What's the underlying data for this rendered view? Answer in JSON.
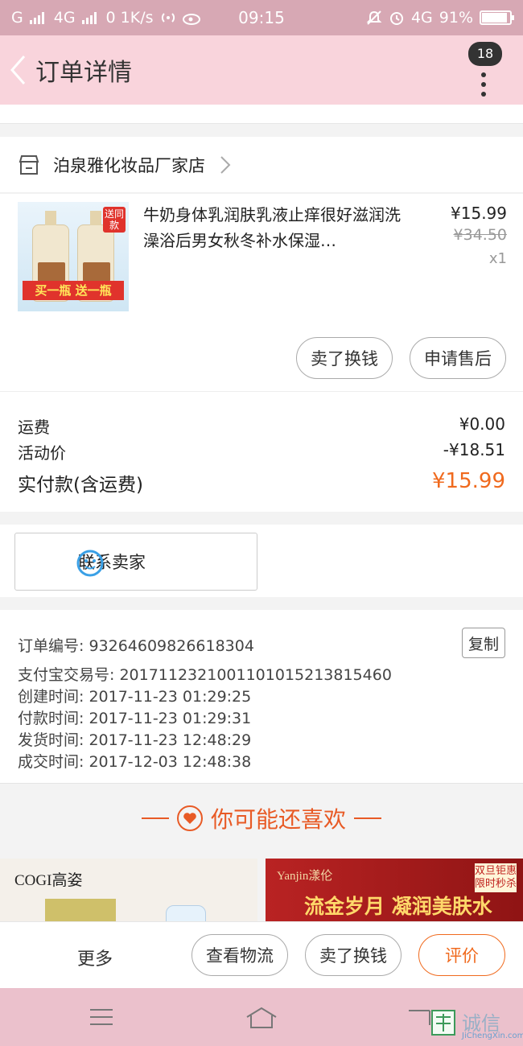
{
  "status_bar": {
    "network_left": "G",
    "network_4g": "4G",
    "speed": "0 1K/s",
    "time": "09:15",
    "network_right": "4G",
    "battery_text": "91%",
    "battery_level": 0.91
  },
  "nav": {
    "title": "订单详情",
    "badge": "18"
  },
  "shop": {
    "name": "泊泉雅化妆品厂家店"
  },
  "goods": {
    "name": "牛奶身体乳润肤乳液止痒很好滋润洗澡浴后男女秋冬补水保湿…",
    "price": "¥15.99",
    "original_price": "¥34.50",
    "quantity": "x1",
    "image_banner": "买一瓶 送一瓶",
    "image_tag": "送同款",
    "resell_label": "卖了换钱",
    "aftersale_label": "申请售后"
  },
  "fees": {
    "shipping_label": "运费",
    "shipping_value": "¥0.00",
    "promo_label": "活动价",
    "promo_value": "-¥18.51",
    "total_label": "实付款(含运费)",
    "total_value": "¥15.99"
  },
  "contact": {
    "label": "联系卖家"
  },
  "order_info": {
    "order_no": "订单编号: 93264609826618304",
    "alipay_no": "支付宝交易号: 2017112321001101015213815460",
    "created": "创建时间: 2017-11-23  01:29:25",
    "paid": "付款时间: 2017-11-23  01:29:31",
    "shipped": "发货时间: 2017-11-23  12:48:29",
    "completed": "成交时间: 2017-12-03  12:48:38",
    "copy_label": "复制"
  },
  "recommend": {
    "heading": "你可能还喜欢",
    "left_brand": "COGI高姿",
    "right_logo": "Yanjin漾伦",
    "right_slogan": "流金岁月 凝润美肤水",
    "right_tag": "双旦钜惠 限时秒杀"
  },
  "actions": {
    "more": "更多",
    "logistics": "查看物流",
    "resell": "卖了换钱",
    "review": "评价"
  },
  "watermark": {
    "text": "诚信",
    "sub": "JiChengXin.com"
  },
  "colors": {
    "status_bar": "#d7a8b4",
    "nav_bar": "#f9d4dc",
    "accent_orange": "#f06a1e",
    "system_nav": "#ebc1cc"
  }
}
